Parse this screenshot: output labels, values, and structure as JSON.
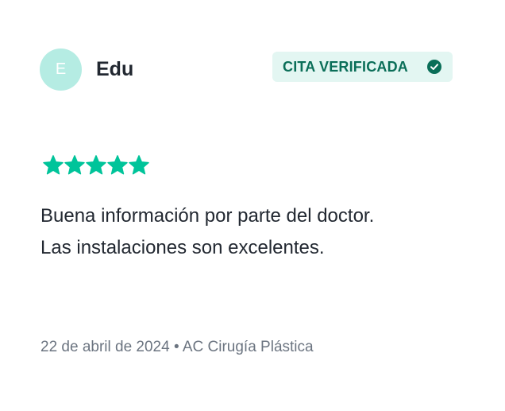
{
  "review": {
    "avatar_letter": "E",
    "author": "Edu",
    "badge": {
      "label": "CITA VERIFICADA",
      "icon": "check-circle-icon"
    },
    "rating": {
      "value": 5,
      "max": 5,
      "color": "#00c49a"
    },
    "text_lines": [
      "Buena información por parte del doctor.",
      "Las instalaciones son excelentes."
    ],
    "date": "22 de abril de 2024",
    "separator": "•",
    "service": "AC Cirugía Plástica"
  },
  "colors": {
    "avatar_bg": "#b5ece3",
    "badge_bg": "#e3f6f2",
    "badge_text": "#0a6e58",
    "text": "#222831",
    "meta": "#6b7480"
  }
}
